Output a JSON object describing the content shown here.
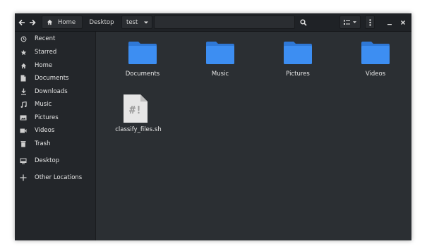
{
  "header": {
    "breadcrumbs": [
      "Home",
      "Desktop",
      "test"
    ],
    "back_icon": "arrow-left-icon",
    "forward_icon": "arrow-right-icon",
    "home_icon": "home-icon"
  },
  "sidebar": {
    "items": [
      {
        "label": "Recent",
        "icon": "clock-icon"
      },
      {
        "label": "Starred",
        "icon": "star-icon"
      },
      {
        "label": "Home",
        "icon": "home-icon"
      },
      {
        "label": "Documents",
        "icon": "document-icon"
      },
      {
        "label": "Downloads",
        "icon": "download-icon"
      },
      {
        "label": "Music",
        "icon": "music-icon"
      },
      {
        "label": "Pictures",
        "icon": "picture-icon"
      },
      {
        "label": "Videos",
        "icon": "video-icon"
      },
      {
        "label": "Trash",
        "icon": "trash-icon"
      },
      {
        "label": "Desktop",
        "icon": "desktop-icon"
      },
      {
        "label": "Other Locations",
        "icon": "plus-icon"
      }
    ]
  },
  "files": [
    {
      "name": "Documents",
      "type": "folder"
    },
    {
      "name": "Music",
      "type": "folder"
    },
    {
      "name": "Pictures",
      "type": "folder"
    },
    {
      "name": "Videos",
      "type": "folder"
    },
    {
      "name": "classify_files.sh",
      "type": "script",
      "icon_text": "#!"
    }
  ],
  "colors": {
    "folder": "#3d8ef2",
    "folder_tab": "#2f78d6",
    "background": "#2b2f33",
    "sidebar": "#23262a",
    "headerbar": "#1f2226"
  }
}
